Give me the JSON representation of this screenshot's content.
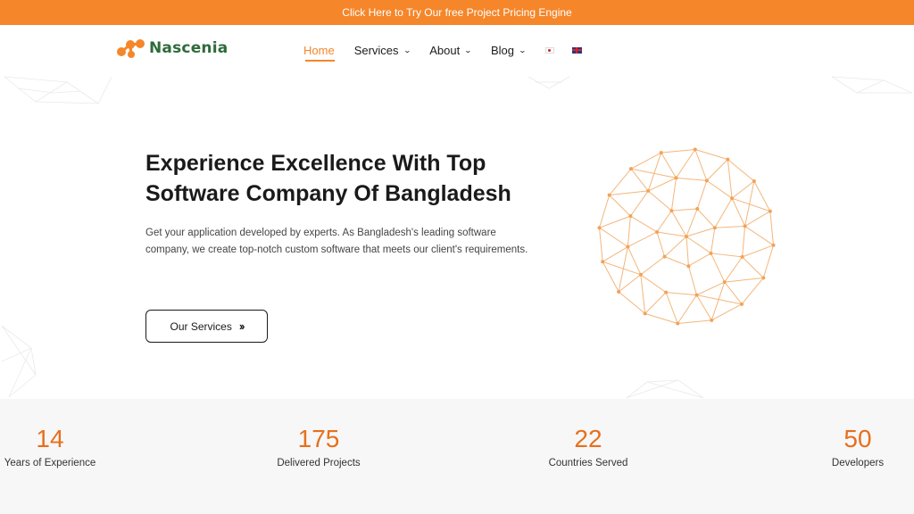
{
  "announcement": {
    "text": "Click Here to Try Our free Project Pricing Engine"
  },
  "brand": {
    "name": "Nascenia"
  },
  "nav": {
    "items": [
      {
        "label": "Home",
        "active": true,
        "dropdown": false
      },
      {
        "label": "Services",
        "active": false,
        "dropdown": true
      },
      {
        "label": "About",
        "active": false,
        "dropdown": true
      },
      {
        "label": "Blog",
        "active": false,
        "dropdown": true
      }
    ],
    "languages": [
      "japanese-flag-icon",
      "uk-flag-icon"
    ]
  },
  "hero": {
    "title_line1": "Experience Excellence With Top",
    "title_line2": "Software Company Of Bangladesh",
    "description": "Get your application developed by experts. As Bangladesh's leading software company, we create top-notch custom software that meets our client's requirements.",
    "button_label": "Our Services",
    "button_icon": "double-chevron-right-icon"
  },
  "stats": [
    {
      "value": "14",
      "label": "Years of Experience"
    },
    {
      "value": "175",
      "label": "Delivered Projects"
    },
    {
      "value": "22",
      "label": "Countries Served"
    },
    {
      "value": "50",
      "label": "Developers"
    }
  ],
  "colors": {
    "accent": "#f5862a",
    "stat_number": "#e86f1d",
    "brand_green": "#2f6b3a",
    "stats_bg": "#f7f7f7"
  }
}
